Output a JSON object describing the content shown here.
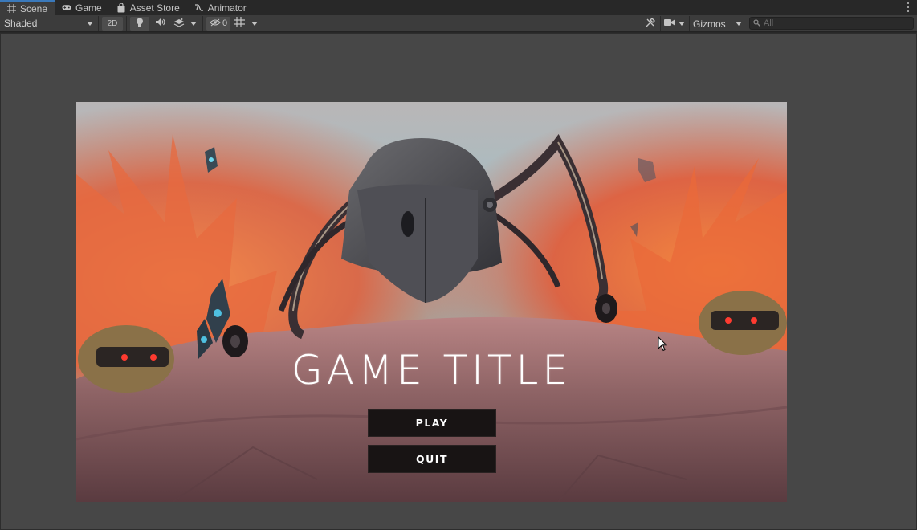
{
  "tabs": [
    {
      "label": "Scene",
      "icon": "grid-icon",
      "active": true
    },
    {
      "label": "Game",
      "icon": "gamepad-icon",
      "active": false
    },
    {
      "label": "Asset Store",
      "icon": "shopping-bag-icon",
      "active": false
    },
    {
      "label": "Animator",
      "icon": "animator-icon",
      "active": false
    }
  ],
  "toolbar": {
    "draw_mode": "Shaded",
    "mode_2d": "2D",
    "hidden_count": "0",
    "gizmos_label": "Gizmos",
    "search_placeholder": "All"
  },
  "game_ui": {
    "title": "GAME TITLE",
    "play_label": "PLAY",
    "quit_label": "QUIT"
  },
  "colors": {
    "editor_bg": "#474747",
    "toolbar_bg": "#3c3c3c",
    "tab_accent": "#3a79bb",
    "button_bg": "#181414",
    "title_text": "#ffffff"
  }
}
